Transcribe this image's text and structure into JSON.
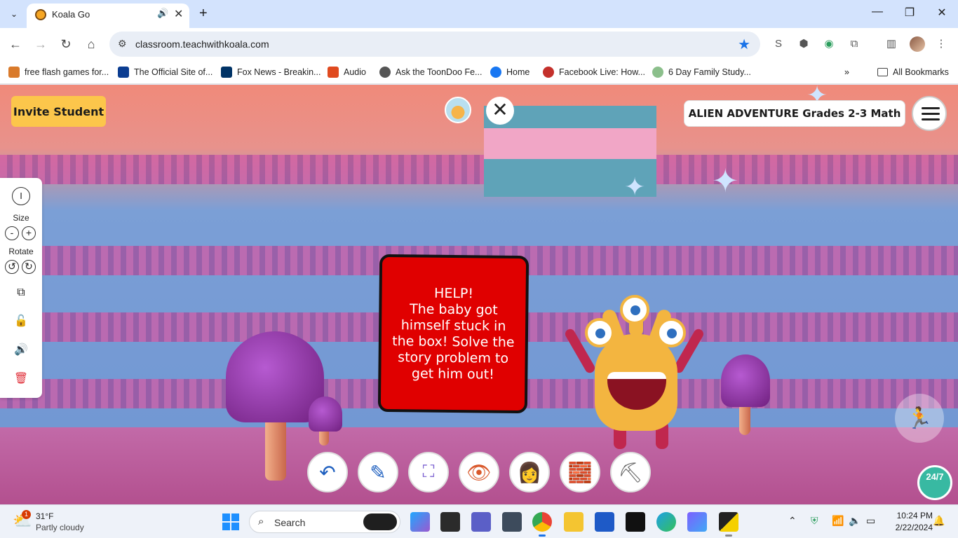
{
  "browser": {
    "tab": {
      "title": "Koala Go"
    },
    "address": {
      "url": "classroom.teachwithkoala.com"
    },
    "bookmarks": [
      {
        "label": "free flash games for...",
        "color": "#d97a2b"
      },
      {
        "label": "The Official Site of...",
        "color": "#0b3d91"
      },
      {
        "label": "Fox News - Breakin...",
        "color": "#003366"
      },
      {
        "label": "Audio",
        "color": "#e04a1f"
      },
      {
        "label": "Ask the ToonDoo Fe...",
        "color": "#555555"
      },
      {
        "label": "Home",
        "color": "#1877f2"
      },
      {
        "label": "Facebook Live: How...",
        "color": "#c4302b"
      },
      {
        "label": "6 Day Family Study...",
        "color": "#8bbf8b"
      }
    ],
    "all_bookmarks_label": "All Bookmarks"
  },
  "scene": {
    "invite_label": "Invite Student",
    "activity_title": "ALIEN ADVENTURE Grades 2-3 Math",
    "panel": {
      "size_label": "Size",
      "size_minus": "-",
      "size_plus": "+",
      "rotate_label": "Rotate"
    },
    "board_text": "HELP!\nThe baby got himself stuck in the box!  Solve the story problem to get him out!",
    "support_label": "24/7"
  },
  "taskbar": {
    "weather_temp": "31°F",
    "weather_desc": "Partly cloudy",
    "weather_badge": "1",
    "search_label": "Search",
    "time": "10:24 PM",
    "date": "2/22/2024"
  }
}
